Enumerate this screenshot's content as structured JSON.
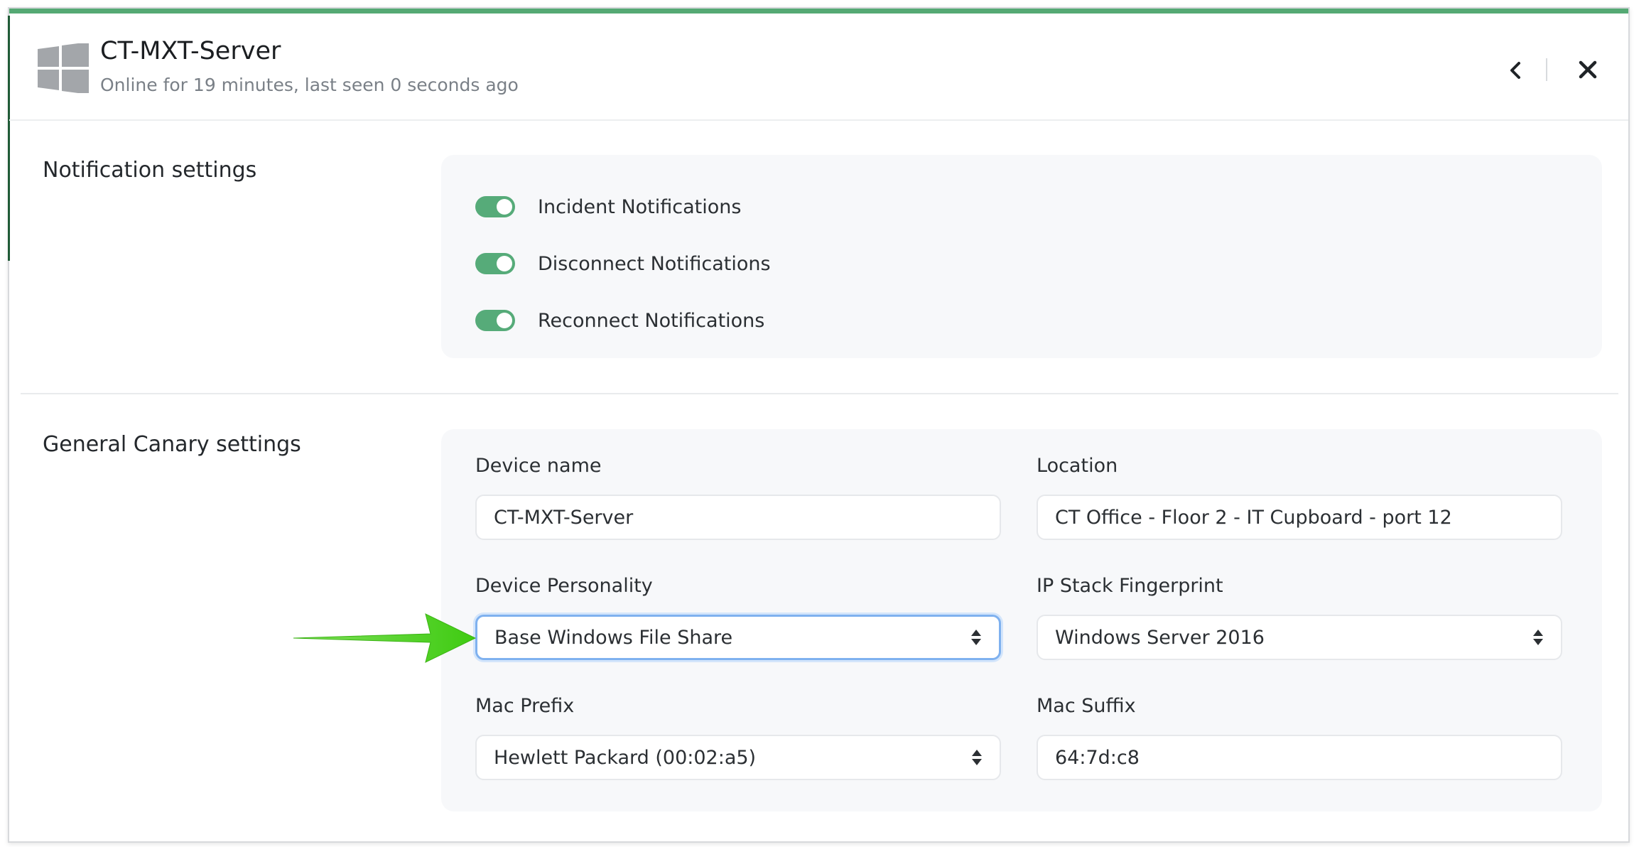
{
  "device": {
    "name": "CT-MXT-Server",
    "status": "Online for 19 minutes, last seen 0 seconds ago",
    "os_icon": "windows-logo-icon"
  },
  "header_actions": {
    "back_icon": "chevron-left-icon",
    "close_icon": "close-icon"
  },
  "notification_settings": {
    "title": "Notification settings",
    "toggles": [
      {
        "label": "Incident Notifications",
        "on": true
      },
      {
        "label": "Disconnect Notifications",
        "on": true
      },
      {
        "label": "Reconnect Notifications",
        "on": true
      }
    ]
  },
  "general_settings": {
    "title": "General Canary settings",
    "device_name": {
      "label": "Device name",
      "value": "CT-MXT-Server"
    },
    "location": {
      "label": "Location",
      "value": "CT Office - Floor 2 - IT Cupboard - port 12"
    },
    "device_personality": {
      "label": "Device Personality",
      "value": "Base Windows File Share"
    },
    "ip_stack_fingerprint": {
      "label": "IP Stack Fingerprint",
      "value": "Windows Server 2016"
    },
    "mac_prefix": {
      "label": "Mac Prefix",
      "value": "Hewlett Packard (00:02:a5)"
    },
    "mac_suffix": {
      "label": "Mac Suffix",
      "value": "64:7d:c8"
    }
  },
  "colors": {
    "accent": "#55a974",
    "toggle_on": "#56ab79",
    "focus_ring": "#7fb1ef",
    "annotation_arrow": "#4fd11f"
  },
  "annotation": {
    "icon": "green-arrow-icon"
  }
}
